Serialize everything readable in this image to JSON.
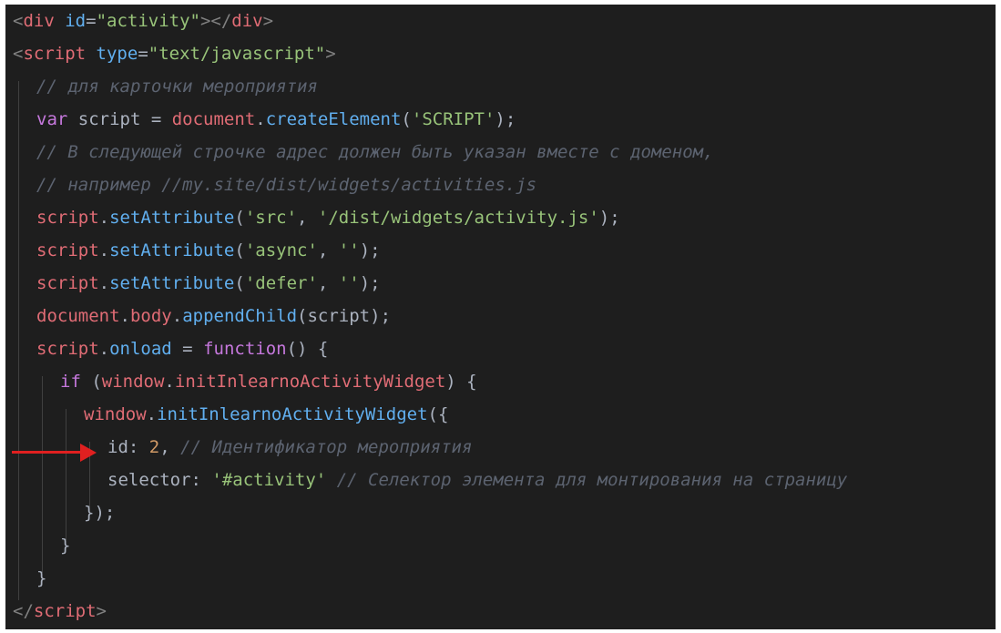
{
  "lines": {
    "l1": {
      "open": "<",
      "tag": "div",
      "attr": "id",
      "eq": "=",
      "val": "\"activity\"",
      "close1": "></",
      "tag2": "div",
      "close2": ">"
    },
    "l2": {
      "open": "<",
      "tag": "script",
      "attr": "type",
      "eq": "=",
      "val": "\"text/javascript\"",
      "close": ">"
    },
    "l3": {
      "comment": "// для карточки мероприятия"
    },
    "l4": {
      "kw": "var",
      "name": " script ",
      "eq": "= ",
      "obj": "document",
      "dot": ".",
      "fn": "createElement",
      "p1": "(",
      "str": "'SCRIPT'",
      "p2": ");"
    },
    "l5": {
      "comment": "// В следующей строчке адрес должен быть указан вместе с доменом,"
    },
    "l6": {
      "comment": "// например //my.site/dist/widgets/activities.js"
    },
    "l7": {
      "obj": "script",
      "dot": ".",
      "fn": "setAttribute",
      "p1": "(",
      "s1": "'src'",
      "c": ", ",
      "s2": "'/dist/widgets/activity.js'",
      "p2": ");"
    },
    "l8": {
      "obj": "script",
      "dot": ".",
      "fn": "setAttribute",
      "p1": "(",
      "s1": "'async'",
      "c": ", ",
      "s2": "''",
      "p2": ");"
    },
    "l9": {
      "obj": "script",
      "dot": ".",
      "fn": "setAttribute",
      "p1": "(",
      "s1": "'defer'",
      "c": ", ",
      "s2": "''",
      "p2": ");"
    },
    "l10": {
      "obj": "document",
      "dot1": ".",
      "prop": "body",
      "dot2": ".",
      "fn": "appendChild",
      "p1": "(",
      "arg": "script",
      "p2": ");"
    },
    "l11": {
      "obj": "script",
      "dot": ".",
      "prop": "onload",
      "eq": " = ",
      "kw": "function",
      "rest": "() {"
    },
    "l12": {
      "kw": "if",
      "p1": " (",
      "obj": "window",
      "dot": ".",
      "prop": "initInlearnoActivityWidget",
      "p2": ") {"
    },
    "l13": {
      "obj": "window",
      "dot": ".",
      "fn": "initInlearnoActivityWidget",
      "p": "({"
    },
    "l14": {
      "key": "id",
      "colon": ": ",
      "num": "2",
      "comma": ", ",
      "comment": "// Идентификатор мероприятия"
    },
    "l15": {
      "key": "selector",
      "colon": ": ",
      "str": "'#activity'",
      "sp": " ",
      "comment": "// Селектор элемента для монтирования на страницу"
    },
    "l16": {
      "text": "});"
    },
    "l17": {
      "text": "}"
    },
    "l18": {
      "text": "}"
    },
    "l19": {
      "open": "</",
      "tag": "script",
      "close": ">"
    }
  },
  "colors": {
    "background": "#1e1e1e",
    "arrow": "#e02020"
  },
  "icons": {
    "arrow": "red-arrow-icon"
  }
}
